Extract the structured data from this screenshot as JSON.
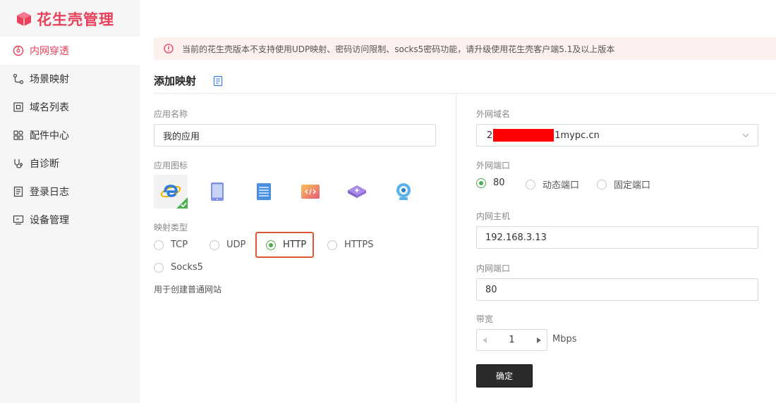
{
  "brand": {
    "name": "花生壳管理",
    "color": "#e8405a"
  },
  "sidebar": {
    "items": [
      {
        "label": "内网穿透",
        "icon": "network-icon",
        "active": true
      },
      {
        "label": "场景映射",
        "icon": "scene-icon",
        "active": false
      },
      {
        "label": "域名列表",
        "icon": "domain-icon",
        "active": false
      },
      {
        "label": "配件中心",
        "icon": "grid-icon",
        "active": false
      },
      {
        "label": "自诊断",
        "icon": "diagnose-icon",
        "active": false
      },
      {
        "label": "登录日志",
        "icon": "log-icon",
        "active": false
      },
      {
        "label": "设备管理",
        "icon": "device-icon",
        "active": false
      }
    ]
  },
  "alert": {
    "text": "当前的花生壳版本不支持使用UDP映射、密码访问限制、socks5密码功能，请升级使用花生壳客户端5.1及以上版本"
  },
  "form": {
    "title": "添加映射",
    "app_name": {
      "label": "应用名称",
      "value": "我的应用"
    },
    "app_icon": {
      "label": "应用图标",
      "icons": [
        "ie-icon",
        "tablet-icon",
        "server-icon",
        "code-icon",
        "box-icon",
        "camera-icon"
      ],
      "selected": 0
    },
    "mapping_type": {
      "label": "映射类型",
      "options": [
        "TCP",
        "UDP",
        "HTTP",
        "HTTPS",
        "Socks5"
      ],
      "selected": "HTTP",
      "hint": "用于创建普通网站"
    },
    "external_domain": {
      "label": "外网域名",
      "value_prefix": "2",
      "value_suffix": "1mypc.cn"
    },
    "external_port": {
      "label": "外网端口",
      "options": [
        "80",
        "动态端口",
        "固定端口"
      ],
      "selected": "80"
    },
    "internal_host": {
      "label": "内网主机",
      "value": "192.168.3.13"
    },
    "internal_port": {
      "label": "内网端口",
      "value": "80"
    },
    "bandwidth": {
      "label": "带宽",
      "value": "1",
      "unit": "Mbps"
    },
    "submit_label": "确定"
  }
}
